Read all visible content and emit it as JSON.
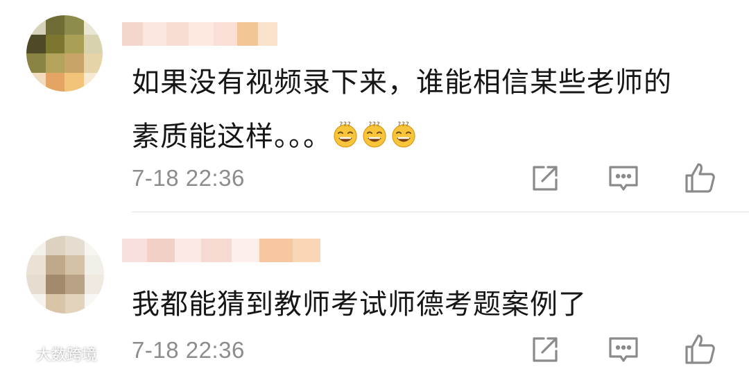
{
  "comments": [
    {
      "text_line1": "如果没有视频录下来，谁能相信某些老师的",
      "text_line2": "素质能这样。。。",
      "emoji_count": 3,
      "emoji_name": "sweat-smile-emoji",
      "time": "7-18 22:36",
      "avatar_colors": [
        "#d6d2b9",
        "#6f6c36",
        "#8e8c4d",
        "#e9e6d3",
        "#4e4a27",
        "#7c7631",
        "#a9a055",
        "#d8d3ae",
        "#8a8444",
        "#b4a35a",
        "#c9a468",
        "#e6d4a8",
        "#f2dcc0",
        "#e4a463",
        "#f1c47a",
        "#f8ead2"
      ],
      "username_colors": [
        "#f3d7cc",
        "#fbe6df",
        "#f7ddd2",
        "#fde9e0",
        "#f9dfd6",
        "#f3c698",
        "#fbe3cb"
      ]
    },
    {
      "text_line1": "我都能猜到教师考试师德考题案例了",
      "time": "7-18 22:36",
      "avatar_colors": [
        "#f4f1ea",
        "#dcd2bf",
        "#e4ddd0",
        "#f7f5f0",
        "#e9e2d5",
        "#c0a98a",
        "#d4c2a6",
        "#f2efe9",
        "#e6ddd0",
        "#a48a6c",
        "#b9a285",
        "#efe9e0",
        "#f6f3ee",
        "#d9c4a8",
        "#e2d3bd",
        "#f9f7f3"
      ],
      "username_colors": [
        "#f8e1dc",
        "#f2d0c6",
        "#fbe9e4",
        "#f6d9d1",
        "#fdf0ec",
        "#f7c7a0",
        "#f9d7b6"
      ]
    }
  ],
  "watermark": "大数跨境",
  "accent_colors": {
    "text": "#161616",
    "time": "#8c8c8c",
    "icon": "#8a8a8a",
    "divider": "#e3e3e3"
  }
}
